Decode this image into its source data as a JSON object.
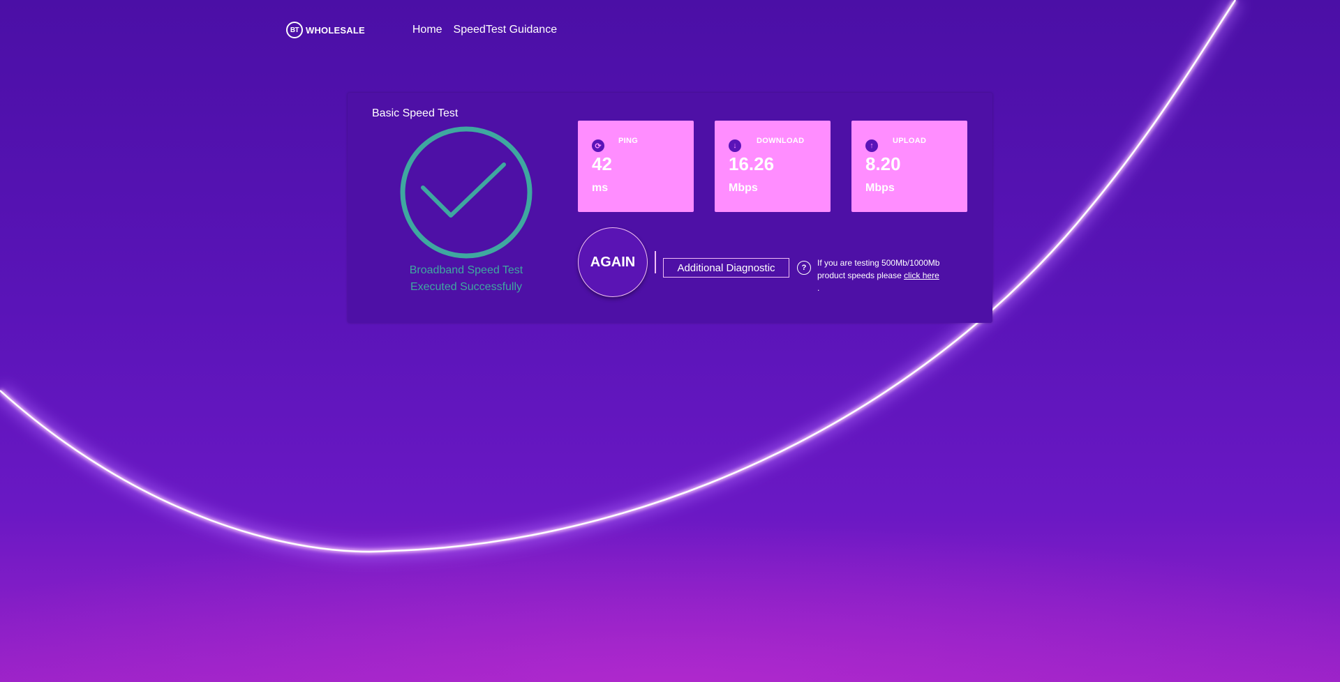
{
  "brand": {
    "logo_mark": "BT",
    "logo_text": "WHOLESALE"
  },
  "nav": {
    "items": [
      {
        "label": "Home"
      },
      {
        "label": "SpeedTest Guidance"
      }
    ]
  },
  "card": {
    "title": "Basic Speed Test",
    "status_line1": "Broadband Speed Test",
    "status_line2": "Executed Successfully",
    "metrics": [
      {
        "label": "PING",
        "value": "42",
        "unit": "ms",
        "icon": "refresh-icon"
      },
      {
        "label": "DOWNLOAD",
        "value": "16.26",
        "unit": "Mbps",
        "icon": "arrow-down-icon"
      },
      {
        "label": "UPLOAD",
        "value": "8.20",
        "unit": "Mbps",
        "icon": "arrow-up-icon"
      }
    ],
    "again_label": "AGAIN",
    "diagnostic_label": "Additional Diagnostic",
    "help": {
      "icon": "question-icon",
      "text": "If you are testing 500Mb/1000Mb product speeds please",
      "link_label": "click here",
      "suffix": "."
    }
  },
  "colors": {
    "background": "#5a14b8",
    "card": "#4e10a6",
    "metric_tile": "#ff8dff",
    "success": "#3fa8a0",
    "accent_border": "#f1bff5"
  }
}
